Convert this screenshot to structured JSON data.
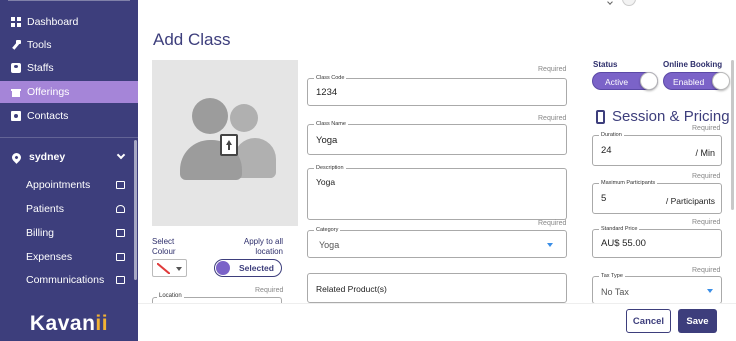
{
  "sidebar": {
    "items": [
      {
        "label": "Dashboard",
        "icon": "dashboard-icon"
      },
      {
        "label": "Tools",
        "icon": "wrench-icon"
      },
      {
        "label": "Staffs",
        "icon": "id-card-icon"
      },
      {
        "label": "Offerings",
        "icon": "gift-icon"
      },
      {
        "label": "Contacts",
        "icon": "contact-book-icon"
      }
    ],
    "active_item": "Offerings",
    "location": "sydney",
    "sub_items": [
      {
        "label": "Appointments",
        "icon": "calendar-icon"
      },
      {
        "label": "Patients",
        "icon": "people-icon"
      },
      {
        "label": "Billing",
        "icon": "card-icon"
      },
      {
        "label": "Expenses",
        "icon": "receipt-icon"
      },
      {
        "label": "Communications",
        "icon": "chat-icon"
      }
    ],
    "logo_main": "Kavan",
    "logo_accent": "ii"
  },
  "page": {
    "title": "Add Class"
  },
  "image_panel": {
    "select_colour_label": "Select\nColour",
    "apply_all_label": "Apply to all\nlocation",
    "selected_label": "Selected",
    "location_required": "Required",
    "location_label": "Location"
  },
  "form": {
    "class_code": {
      "label": "Class Code",
      "value": "1234",
      "required": "Required"
    },
    "class_name": {
      "label": "Class Name",
      "value": "Yoga",
      "required": "Required"
    },
    "description": {
      "label": "Description",
      "value": "Yoga"
    },
    "category": {
      "label": "Category",
      "value": "Yoga",
      "required": "Required"
    },
    "related_products": {
      "placeholder": "Related Product(s)"
    }
  },
  "status": {
    "label": "Status",
    "value": "Active",
    "online_booking_label": "Online Booking",
    "online_booking_value": "Enabled"
  },
  "session": {
    "title": "Session & Pricing",
    "duration": {
      "label": "Duration",
      "value": "24",
      "unit": "/ Min",
      "required": "Required"
    },
    "max_participants": {
      "label": "Maximum Participants",
      "value": "5",
      "unit": "/ Participants",
      "required": "Required"
    },
    "standard_price": {
      "label": "Standard Price",
      "value": "AU$ 55.00",
      "required": "Required"
    },
    "tax_type": {
      "label": "Tax Type",
      "value": "No Tax",
      "required": "Required"
    }
  },
  "footer": {
    "cancel_label": "Cancel",
    "save_label": "Save"
  },
  "colors": {
    "sidebar_bg": "#3d3e7c",
    "active_bg": "#a585d8",
    "accent": "#7b63c8",
    "logo_accent": "#f2b233"
  }
}
